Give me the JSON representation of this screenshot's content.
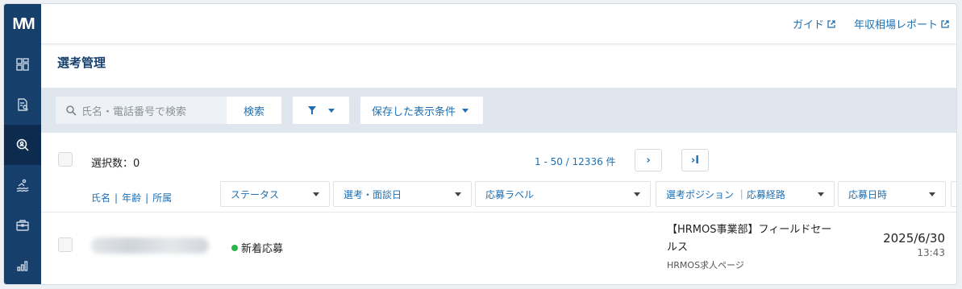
{
  "logo": {
    "text": "M"
  },
  "topbar": {
    "guide_label": "ガイド",
    "salary_report_label": "年収相場レポート"
  },
  "page": {
    "title": "選考管理"
  },
  "search": {
    "placeholder": "氏名・電話番号で検索",
    "button_label": "検索",
    "saved_conditions_label": "保存した表示条件"
  },
  "list": {
    "selection_count": "選択数：0",
    "pagination": "1 - 50 / 12336 件",
    "next_label": "›",
    "last_label": "›I",
    "name_columns": [
      "氏名",
      "年齢",
      "所属"
    ],
    "columns": [
      "ステータス",
      "選考・面談日",
      "応募ラベル",
      "選考ポジション ｜応募経路",
      "応募日時"
    ]
  },
  "rows": [
    {
      "status": "新着応募",
      "status_color": "#2db34a",
      "position": "【HRMOS事業部】フィールドセールス",
      "route": "HRMOS求人ページ",
      "date": "2025/6/30",
      "time": "13:43"
    }
  ],
  "colors": {
    "sidebar": "#173f6b",
    "accent": "#1f6fb2"
  }
}
